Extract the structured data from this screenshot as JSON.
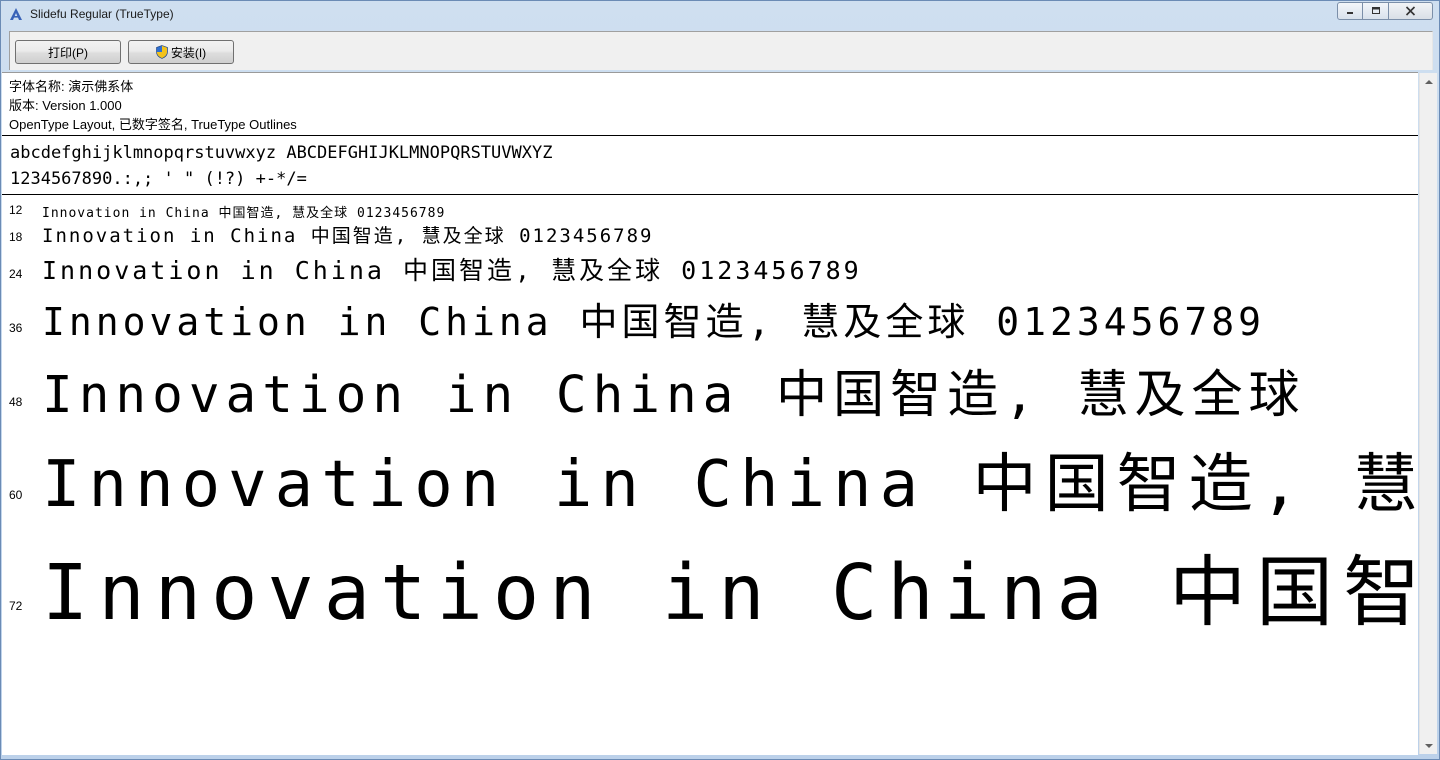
{
  "window": {
    "title": "Slidefu Regular (TrueType)",
    "icon": "font-viewer-icon"
  },
  "caption": {
    "minimize": "minimize-icon",
    "maximize": "maximize-icon",
    "close": "close-icon"
  },
  "toolbar": {
    "print_label": "打印(P)",
    "install_label": "安装(I)"
  },
  "info": {
    "font_name": "字体名称: 演示佛系体",
    "version": "版本: Version 1.000",
    "details": "OpenType Layout, 已数字签名, TrueType Outlines"
  },
  "charset": {
    "letters": "abcdefghijklmnopqrstuvwxyz ABCDEFGHIJKLMNOPQRSTUVWXYZ",
    "symbols": "1234567890.:,; ' \" (!?) +-*/="
  },
  "samples": [
    {
      "size": "12",
      "text": "Innovation in China 中国智造, 慧及全球 0123456789"
    },
    {
      "size": "18",
      "text": "Innovation in China 中国智造, 慧及全球 0123456789"
    },
    {
      "size": "24",
      "text": "Innovation in China 中国智造, 慧及全球 0123456789"
    },
    {
      "size": "36",
      "text": "Innovation in China 中国智造, 慧及全球 0123456789"
    },
    {
      "size": "48",
      "text": "Innovation in China 中国智造, 慧及全球"
    },
    {
      "size": "60",
      "text": "Innovation in China 中国智造, 慧"
    },
    {
      "size": "72",
      "text": "Innovation in China 中国智"
    }
  ]
}
